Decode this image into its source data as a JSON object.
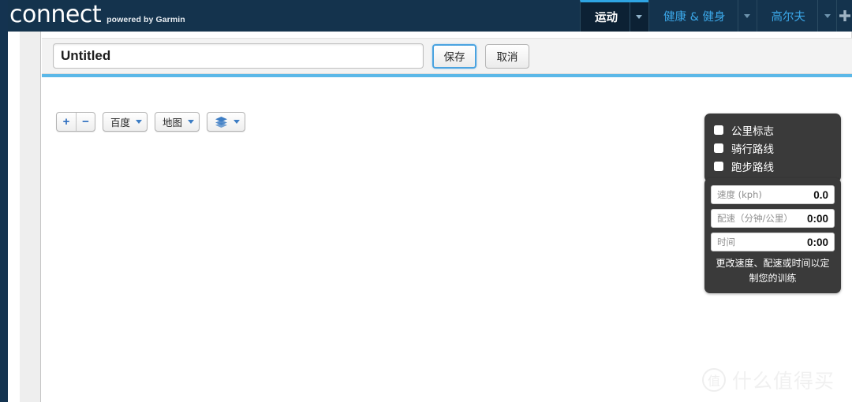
{
  "header": {
    "logo_word": "connect",
    "logo_tagline": "powered by Garmin",
    "nav": [
      {
        "label": "运动",
        "active": true,
        "caret": "chevron-down-icon"
      },
      {
        "label": "健康 & 健身",
        "active": false,
        "caret": "chevron-down-icon"
      },
      {
        "label": "高尔夫",
        "active": false,
        "caret": "chevron-down-icon"
      }
    ],
    "add_icon": "plus-icon"
  },
  "title_bar": {
    "course_name_value": "Untitled",
    "course_name_placeholder": "Untitled",
    "save_label": "保存",
    "cancel_label": "取消"
  },
  "map_toolbar": {
    "zoom_in_label": "+",
    "zoom_out_label": "−",
    "provider_label": "百度",
    "view_label": "地图",
    "layers_icon": "layers-stack-icon"
  },
  "layers_panel": {
    "items": [
      {
        "label": "公里标志",
        "checked": false
      },
      {
        "label": "骑行路线",
        "checked": false
      },
      {
        "label": "跑步路线",
        "checked": false
      }
    ]
  },
  "stats_panel": {
    "rows": [
      {
        "label": "速度 (kph)",
        "value": "0.0"
      },
      {
        "label": "配速（分钟/公里）",
        "value": "0:00"
      },
      {
        "label": "时间",
        "value": "0:00"
      }
    ],
    "hint": "更改速度、配速或时间以定制您的训练"
  },
  "watermark": {
    "badge": "值",
    "text": "什么值得买"
  },
  "colors": {
    "header_bg": "#14334d",
    "active_tab_bg": "#0c2134",
    "accent_blue": "#5bb8e8",
    "nav_link": "#3ba7e8",
    "panel_bg": "#3a3a3a",
    "primary_btn_border": "#4aa3e0"
  }
}
